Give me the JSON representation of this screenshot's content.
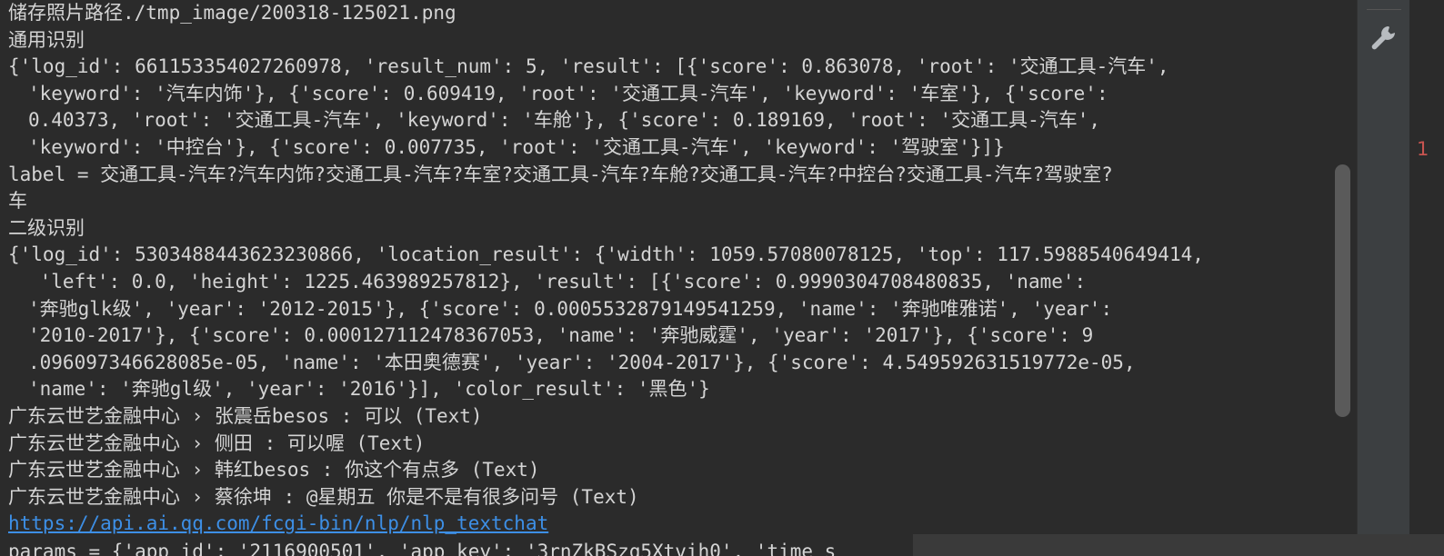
{
  "console": {
    "lines": [
      {
        "text": "储存照片路径./tmp_image/200318-125021.png",
        "kind": "plain"
      },
      {
        "text": "通用识别",
        "kind": "plain"
      },
      {
        "text": "{'log_id': 661153354027260978, 'result_num': 5, 'result': [{'score': 0.863078, 'root': '交通工具-汽车',",
        "kind": "plain"
      },
      {
        "text": "'keyword': '汽车内饰'}, {'score': 0.609419, 'root': '交通工具-汽车', 'keyword': '车室'}, {'score':",
        "kind": "cont"
      },
      {
        "text": "0.40373, 'root': '交通工具-汽车', 'keyword': '车舱'}, {'score': 0.189169, 'root': '交通工具-汽车',",
        "kind": "cont"
      },
      {
        "text": "'keyword': '中控台'}, {'score': 0.007735, 'root': '交通工具-汽车', 'keyword': '驾驶室'}]}",
        "kind": "cont"
      },
      {
        "text": "label = 交通工具-汽车?汽车内饰?交通工具-汽车?车室?交通工具-汽车?车舱?交通工具-汽车?中控台?交通工具-汽车?驾驶室?",
        "kind": "plain"
      },
      {
        "text": "车",
        "kind": "plain"
      },
      {
        "text": "二级识别",
        "kind": "plain"
      },
      {
        "text": "{'log_id': 5303488443623230866, 'location_result': {'width': 1059.57080078125, 'top': 117.5988540649414,",
        "kind": "plain"
      },
      {
        "text": " 'left': 0.0, 'height': 1225.463989257812}, 'result': [{'score': 0.9990304708480835, 'name':",
        "kind": "cont"
      },
      {
        "text": "'奔驰glk级', 'year': '2012-2015'}, {'score': 0.0005532879149541259, 'name': '奔驰唯雅诺', 'year':",
        "kind": "cont"
      },
      {
        "text": "'2010-2017'}, {'score': 0.000127112478367053, 'name': '奔驰威霆', 'year': '2017'}, {'score': 9",
        "kind": "cont"
      },
      {
        "text": ".096097346628085e-05, 'name': '本田奥德赛', 'year': '2004-2017'}, {'score': 4.549592631519772e-05,",
        "kind": "cont"
      },
      {
        "text": "'name': '奔驰gl级', 'year': '2016'}], 'color_result': '黑色'}",
        "kind": "cont"
      },
      {
        "text": "广东云世艺金融中心 › 张震岳besos : 可以 (Text)",
        "kind": "plain"
      },
      {
        "text": "广东云世艺金融中心 › 侧田 : 可以喔 (Text)",
        "kind": "plain"
      },
      {
        "text": "广东云世艺金融中心 › 韩红besos : 你这个有点多 (Text)",
        "kind": "plain"
      },
      {
        "text": "广东云世艺金融中心 › 蔡徐坤 : @星期五 你是不是有很多问号 (Text)",
        "kind": "plain"
      },
      {
        "text": "https://api.ai.qq.com/fcgi-bin/nlp/nlp_textchat",
        "kind": "link"
      },
      {
        "text": "params = {'app_id': '2116900501', 'app_key': '3rnZkBSzq5Xtvih0', 'time_s",
        "kind": "params"
      }
    ]
  },
  "gutter": {
    "mark": "1"
  },
  "toolbar": {
    "settings_icon": "wrench-icon"
  },
  "colors": {
    "background": "#2b2b2b",
    "text": "#d4d4d4",
    "link": "#3d8fe6",
    "toolbar": "#3c3f41",
    "scroll_thumb": "#5a5a5a",
    "gutter_mark": "#c75450"
  }
}
